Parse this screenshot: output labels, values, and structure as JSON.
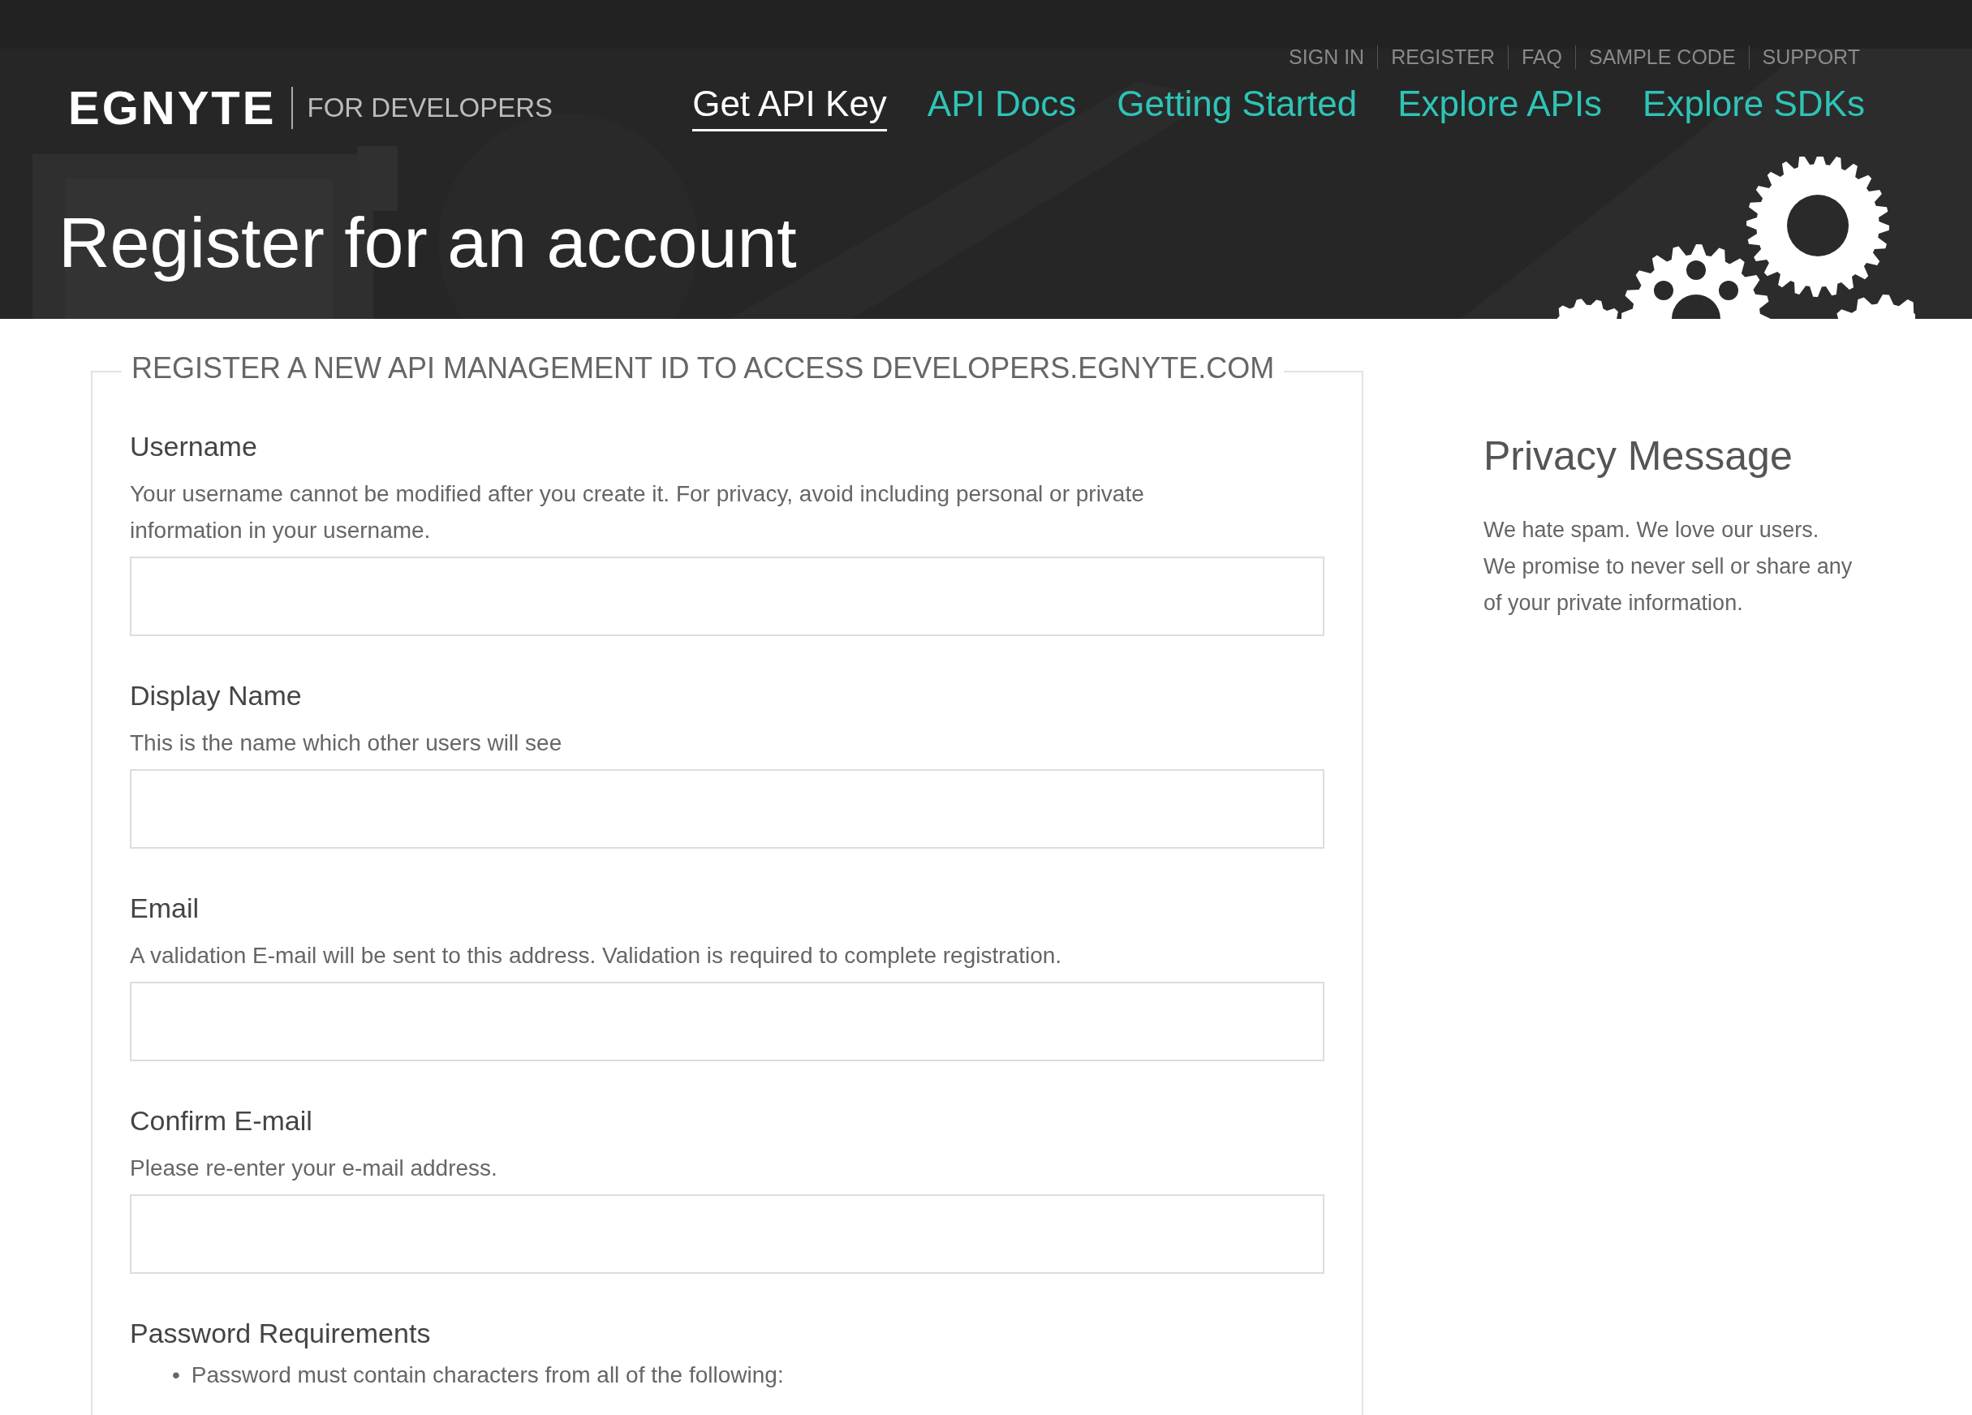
{
  "header": {
    "logo": {
      "brand": "EGNYTE",
      "tagline": "FOR DEVELOPERS"
    },
    "top_links": [
      {
        "label": "SIGN IN"
      },
      {
        "label": "REGISTER"
      },
      {
        "label": "FAQ"
      },
      {
        "label": "SAMPLE CODE"
      },
      {
        "label": "SUPPORT"
      }
    ],
    "nav": [
      {
        "label": "Get API Key",
        "selected": true
      },
      {
        "label": "API Docs",
        "selected": false
      },
      {
        "label": "Getting Started",
        "selected": false
      },
      {
        "label": "Explore APIs",
        "selected": false
      },
      {
        "label": "Explore SDKs",
        "selected": false
      }
    ],
    "title": "Register for an account"
  },
  "form": {
    "legend": "REGISTER A NEW API MANAGEMENT ID TO ACCESS DEVELOPERS.EGNYTE.COM",
    "fields": [
      {
        "label": "Username",
        "help": "Your username cannot be modified after you create it. For privacy, avoid including personal or private information in your username."
      },
      {
        "label": "Display Name",
        "help": "This is the name which other users will see"
      },
      {
        "label": "Email",
        "help": "A validation E-mail will be sent to this address. Validation is required to complete registration."
      },
      {
        "label": "Confirm E-mail",
        "help": "Please re-enter your e-mail address."
      }
    ],
    "password_requirements": {
      "title": "Password Requirements",
      "items": [
        {
          "bullet": "•",
          "text": "Password must contain characters from all of the following:"
        }
      ]
    }
  },
  "privacy": {
    "title": "Privacy Message",
    "text": "We hate spam. We love our users. We promise to never sell or share any of your private information."
  }
}
